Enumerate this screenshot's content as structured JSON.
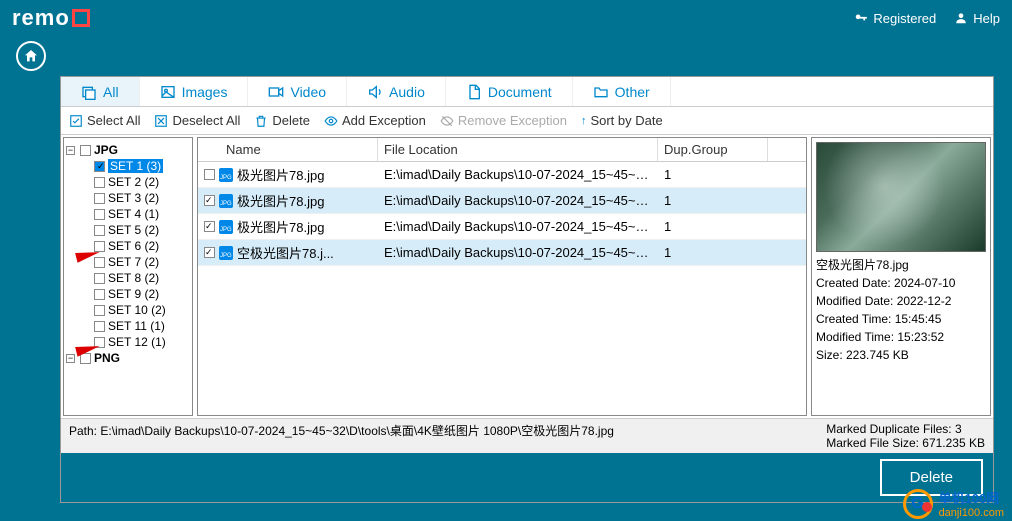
{
  "brand": "remo",
  "top": {
    "registered": "Registered",
    "help": "Help"
  },
  "tabs": {
    "all": "All",
    "images": "Images",
    "video": "Video",
    "audio": "Audio",
    "document": "Document",
    "other": "Other"
  },
  "toolbar": {
    "select_all": "Select All",
    "deselect_all": "Deselect All",
    "delete": "Delete",
    "add_exception": "Add Exception",
    "remove_exception": "Remove Exception",
    "sort": "Sort by Date"
  },
  "tree": {
    "root": "JPG",
    "last": "PNG",
    "items": [
      {
        "label": "SET 1 (3)",
        "checked": true,
        "selected": true
      },
      {
        "label": "SET 2 (2)",
        "checked": false
      },
      {
        "label": "SET 3 (2)",
        "checked": false
      },
      {
        "label": "SET 4 (1)",
        "checked": false
      },
      {
        "label": "SET 5 (2)",
        "checked": false
      },
      {
        "label": "SET 6 (2)",
        "checked": false
      },
      {
        "label": "SET 7 (2)",
        "checked": false
      },
      {
        "label": "SET 8 (2)",
        "checked": false
      },
      {
        "label": "SET 9 (2)",
        "checked": false
      },
      {
        "label": "SET 10 (2)",
        "checked": false
      },
      {
        "label": "SET 11 (1)",
        "checked": false
      },
      {
        "label": "SET 12 (1)",
        "checked": false
      }
    ]
  },
  "columns": {
    "name": "Name",
    "loc": "File Location",
    "grp": "Dup.Group"
  },
  "files": [
    {
      "checked": false,
      "name": "极光图片78.jpg",
      "loc": "E:\\imad\\Daily Backups\\10-07-2024_15~45~32\\...",
      "grp": "1",
      "sel": false
    },
    {
      "checked": true,
      "name": "极光图片78.jpg",
      "loc": "E:\\imad\\Daily Backups\\10-07-2024_15~45~32\\...",
      "grp": "1",
      "sel": true
    },
    {
      "checked": true,
      "name": "极光图片78.jpg",
      "loc": "E:\\imad\\Daily Backups\\10-07-2024_15~45~32\\...",
      "grp": "1",
      "sel": false
    },
    {
      "checked": true,
      "name": "空极光图片78.j...",
      "loc": "E:\\imad\\Daily Backups\\10-07-2024_15~45~32\\...",
      "grp": "1",
      "sel": true
    }
  ],
  "preview": {
    "filename": "空极光图片78.jpg",
    "created_date": "Created Date: 2024-07-10",
    "modified_date": "Modified Date: 2022-12-2",
    "created_time": "Created Time: 15:45:45",
    "modified_time": "Modified Time: 15:23:52",
    "size": "Size: 223.745 KB"
  },
  "status": {
    "path": "Path:  E:\\imad\\Daily Backups\\10-07-2024_15~45~32\\D\\tools\\桌面\\4K壁纸图片 1080P\\空极光图片78.jpg",
    "marked_files": "Marked Duplicate Files: 3",
    "marked_size": "Marked File Size: 671.235 KB"
  },
  "delete_btn": "Delete",
  "watermark": {
    "line1": "单机100网",
    "line2": "danji100.com"
  }
}
